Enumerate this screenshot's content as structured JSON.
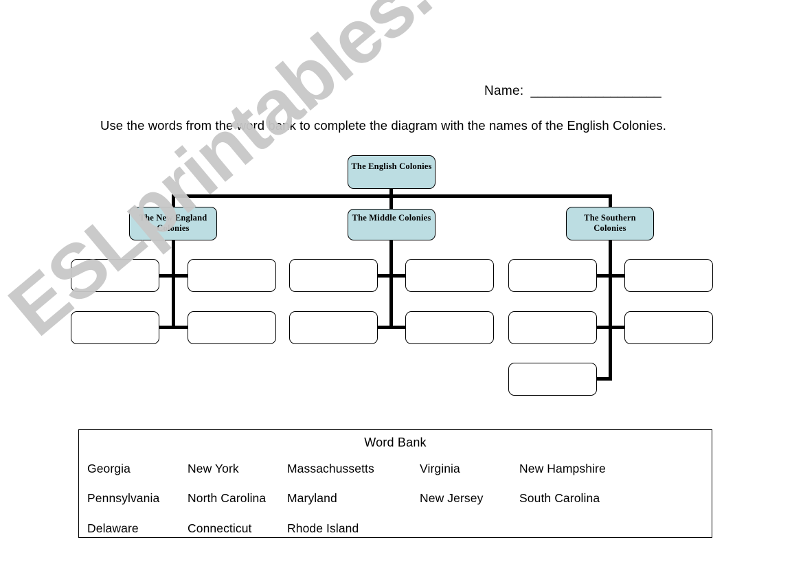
{
  "page": {
    "name_field": {
      "label": "Name:",
      "blank": "__________________"
    },
    "instructions": "Use the words from the word bank to complete the diagram with the names of the English Colonies.",
    "watermark": "ESLprintables.com"
  },
  "colors": {
    "node_fill": "#bcdde2",
    "line": "#000000",
    "watermark": "#c8c8c8",
    "page_background": "#ffffff"
  },
  "diagram": {
    "root": {
      "label": "The English Colonies"
    },
    "branches": [
      {
        "label": "The New England Colonies",
        "blank_boxes": 4
      },
      {
        "label": "The Middle Colonies",
        "blank_boxes": 4
      },
      {
        "label": "The Southern Colonies",
        "blank_boxes": 5
      }
    ]
  },
  "word_bank": {
    "title": "Word Bank",
    "rows": [
      [
        "Georgia",
        "New York",
        "Massachussetts",
        "Virginia",
        "New Hampshire"
      ],
      [
        "Pennsylvania",
        "North Carolina",
        "Maryland",
        "New Jersey",
        "South Carolina"
      ],
      [
        "Delaware",
        "Connecticut",
        "Rhode Island"
      ]
    ]
  }
}
